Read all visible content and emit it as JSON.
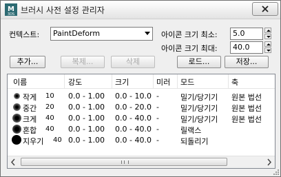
{
  "window": {
    "title": "브러시 사전 설정 관리자",
    "app_icon_text": "M\n3DS"
  },
  "controls": {
    "context_label": "컨텍스트:",
    "context_value": "PaintDeform",
    "icon_min_label": "아이콘 크기 최소:",
    "icon_min_value": "5.0",
    "icon_max_label": "아이콘 크기 최대:",
    "icon_max_value": "40.0"
  },
  "toolbar": {
    "add": "추가...",
    "duplicate": "복제...",
    "delete": "삭제",
    "load": "로드...",
    "save": "저장..."
  },
  "table": {
    "columns": [
      "이름",
      "강도",
      "크기",
      "미러",
      "모드",
      "축"
    ],
    "rows": [
      {
        "name": "작게",
        "num": "10",
        "strength": "0.0 - 1.00",
        "size": "0.0 - 10.0",
        "mirror": "-",
        "mode": "밀기/당기기",
        "axis": "원본 법선"
      },
      {
        "name": "중간",
        "num": "20",
        "strength": "0.0 - 1.00",
        "size": "0.0 - 20.0",
        "mirror": "-",
        "mode": "밀기/당기기",
        "axis": "원본 법선"
      },
      {
        "name": "크게",
        "num": "40",
        "strength": "0.0 - 1.00",
        "size": "0.0 - 40.0",
        "mirror": "-",
        "mode": "밀기/당기기",
        "axis": "원본 법선"
      },
      {
        "name": "혼합",
        "num": "40",
        "strength": "0.0 - 1.00",
        "size": "0.0 - 40.0",
        "mirror": "-",
        "mode": "릴랙스",
        "axis": ""
      },
      {
        "name": "지우기",
        "num": "40",
        "strength": "0.0 - 1.00",
        "size": "0.0 - 40.0",
        "mirror": "-",
        "mode": "되돌리기",
        "axis": ""
      }
    ]
  }
}
